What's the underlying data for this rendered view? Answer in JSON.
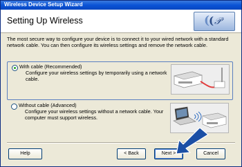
{
  "window": {
    "title": "Wireless Device Setup Wizard"
  },
  "header": {
    "title": "Setting Up Wireless"
  },
  "intro": "The most secure way to configure your device is to connect it to your wired network with a standard network cable. You can then configure its wireless settings and remove the network cable.",
  "options": [
    {
      "label": "With cable (Recommended)",
      "description": "Configure your wireless settings by temporarily using a network cable.",
      "selected": true
    },
    {
      "label": "Without cable (Advanced)",
      "description": "Configure your wireless settings without a network cable. Your computer must support wireless.",
      "selected": false
    }
  ],
  "buttons": {
    "help": "Help",
    "back": "< Back",
    "next": "Next >",
    "cancel": "Cancel"
  },
  "colors": {
    "title_bar": "#0a53d6",
    "accent": "#1b4fa5",
    "cable": "#e23b3b",
    "radio_dot": "#21a121"
  },
  "icons": {
    "brand": "brother-brand-logo",
    "arrow": "pointer-arrow-icon",
    "option1": "printer-router-cable-illustration",
    "option2": "laptop-wireless-printer-illustration"
  }
}
